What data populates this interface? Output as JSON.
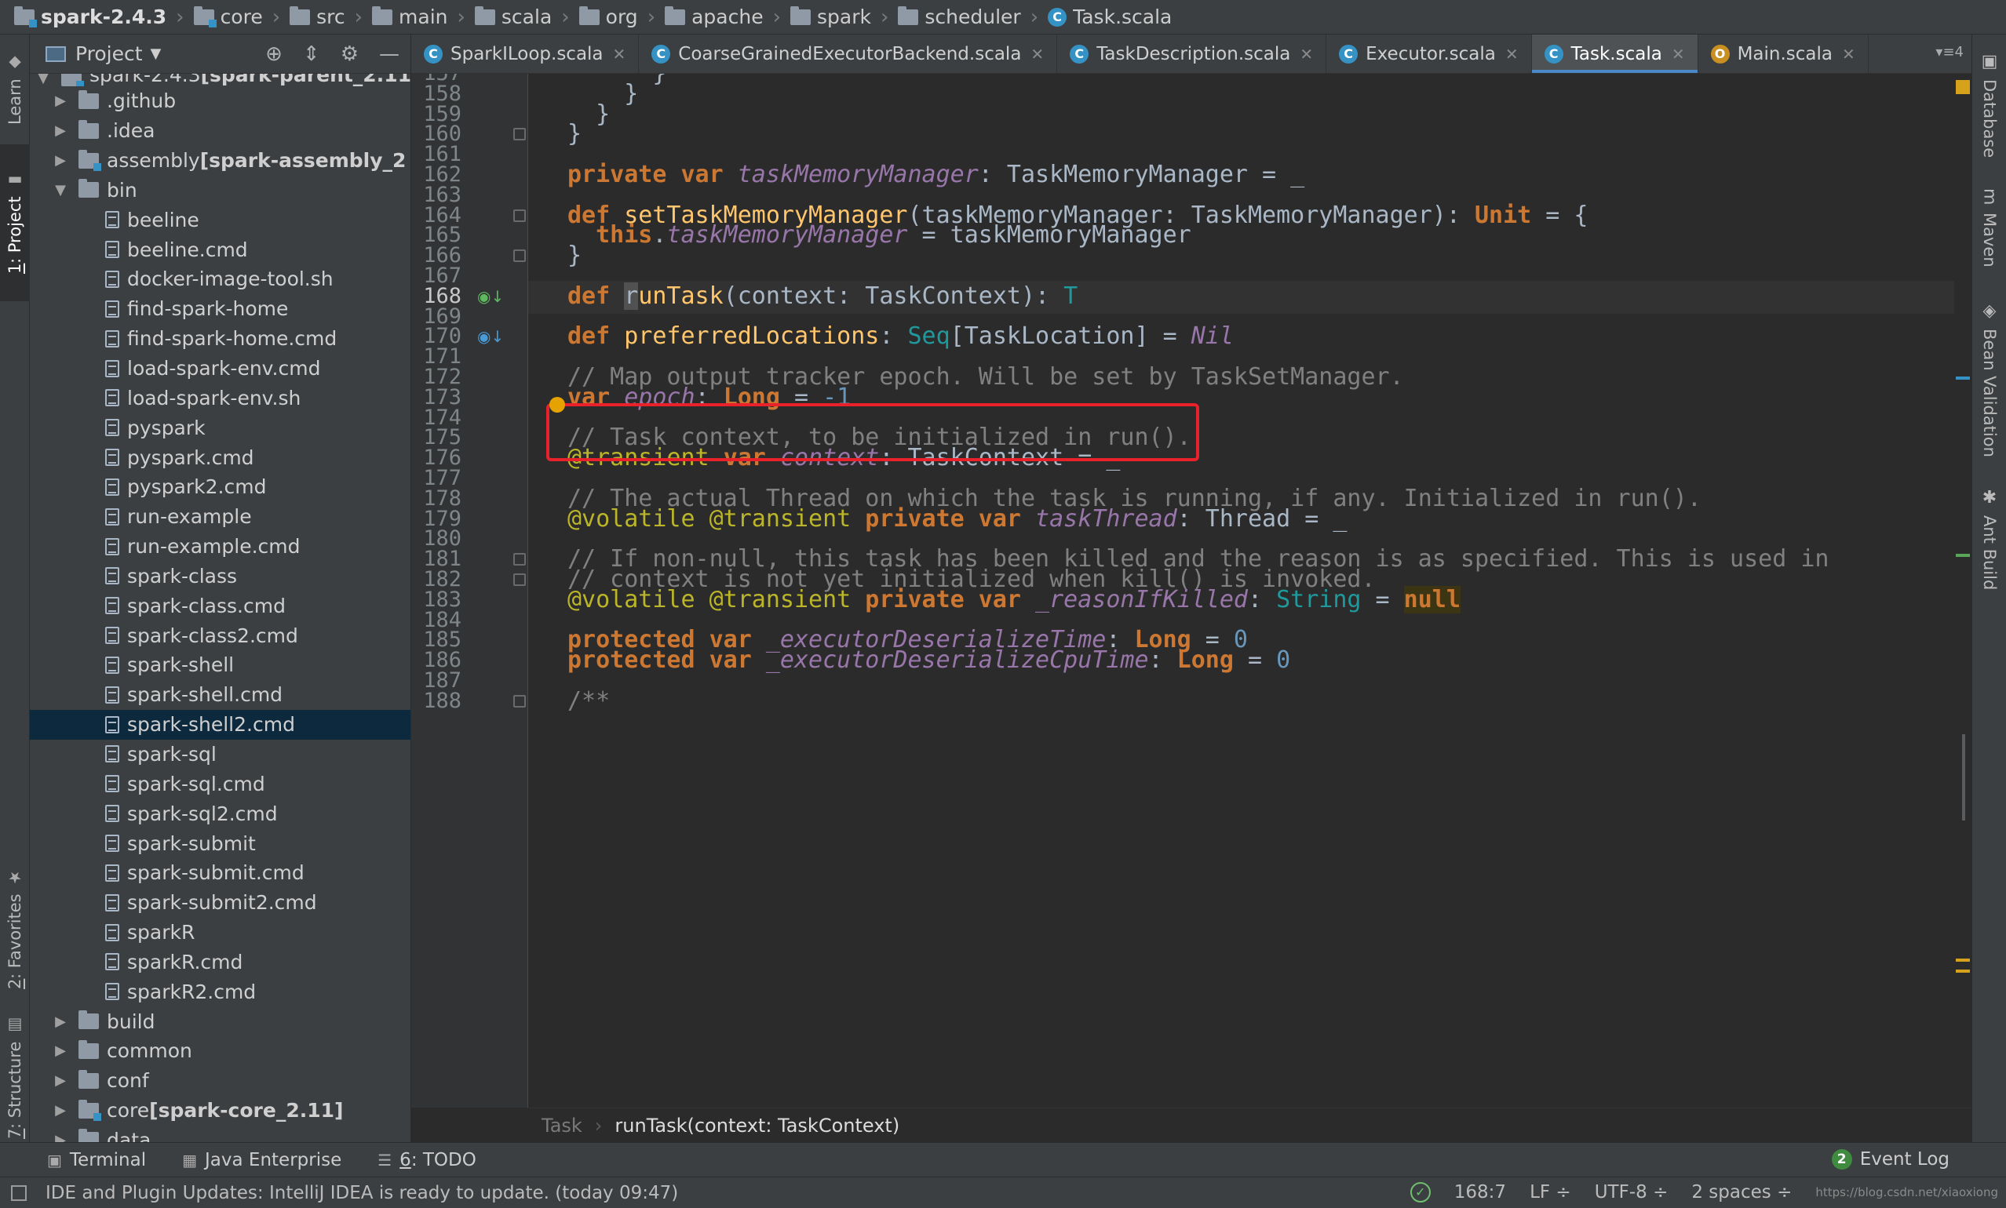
{
  "breadcrumbs": [
    "spark-2.4.3",
    "core",
    "src",
    "main",
    "scala",
    "org",
    "apache",
    "spark",
    "scheduler",
    "Task.scala"
  ],
  "left_tool_windows": {
    "learn": "Learn",
    "project_num": "1",
    "project": ": Project",
    "favorites_num": "2",
    "favorites": ": Favorites",
    "structure_num": "7",
    "structure": ": Structure"
  },
  "project_panel": {
    "title": "Project",
    "partial_top_row": "spark-2.4.3 [spark-parent_2.11",
    "items": [
      {
        "label": "spark-2.4.3",
        "suffix": " [spark-parent_2.11",
        "type": "module",
        "depth": 0,
        "expanded": true
      },
      {
        "label": ".github",
        "type": "folder",
        "depth": 1,
        "expanded": false
      },
      {
        "label": ".idea",
        "type": "folder",
        "depth": 1,
        "expanded": false
      },
      {
        "label": "assembly",
        "suffix": " [spark-assembly_2",
        "type": "module",
        "depth": 1,
        "expanded": false
      },
      {
        "label": "bin",
        "type": "folder",
        "depth": 1,
        "expanded": true
      },
      {
        "label": "beeline",
        "type": "file",
        "depth": 2
      },
      {
        "label": "beeline.cmd",
        "type": "file",
        "depth": 2
      },
      {
        "label": "docker-image-tool.sh",
        "type": "file",
        "depth": 2
      },
      {
        "label": "find-spark-home",
        "type": "file",
        "depth": 2
      },
      {
        "label": "find-spark-home.cmd",
        "type": "file",
        "depth": 2
      },
      {
        "label": "load-spark-env.cmd",
        "type": "file",
        "depth": 2
      },
      {
        "label": "load-spark-env.sh",
        "type": "file",
        "depth": 2
      },
      {
        "label": "pyspark",
        "type": "file",
        "depth": 2
      },
      {
        "label": "pyspark.cmd",
        "type": "file",
        "depth": 2
      },
      {
        "label": "pyspark2.cmd",
        "type": "file",
        "depth": 2
      },
      {
        "label": "run-example",
        "type": "file",
        "depth": 2
      },
      {
        "label": "run-example.cmd",
        "type": "file",
        "depth": 2
      },
      {
        "label": "spark-class",
        "type": "file",
        "depth": 2
      },
      {
        "label": "spark-class.cmd",
        "type": "file",
        "depth": 2
      },
      {
        "label": "spark-class2.cmd",
        "type": "file",
        "depth": 2
      },
      {
        "label": "spark-shell",
        "type": "file",
        "depth": 2
      },
      {
        "label": "spark-shell.cmd",
        "type": "file",
        "depth": 2
      },
      {
        "label": "spark-shell2.cmd",
        "type": "file",
        "depth": 2,
        "selected": true
      },
      {
        "label": "spark-sql",
        "type": "file",
        "depth": 2
      },
      {
        "label": "spark-sql.cmd",
        "type": "file",
        "depth": 2
      },
      {
        "label": "spark-sql2.cmd",
        "type": "file",
        "depth": 2
      },
      {
        "label": "spark-submit",
        "type": "file",
        "depth": 2
      },
      {
        "label": "spark-submit.cmd",
        "type": "file",
        "depth": 2
      },
      {
        "label": "spark-submit2.cmd",
        "type": "file",
        "depth": 2
      },
      {
        "label": "sparkR",
        "type": "file",
        "depth": 2
      },
      {
        "label": "sparkR.cmd",
        "type": "file",
        "depth": 2
      },
      {
        "label": "sparkR2.cmd",
        "type": "file",
        "depth": 2
      },
      {
        "label": "build",
        "type": "folder",
        "depth": 1,
        "expanded": false
      },
      {
        "label": "common",
        "type": "folder",
        "depth": 1,
        "expanded": false
      },
      {
        "label": "conf",
        "type": "folder",
        "depth": 1,
        "expanded": false
      },
      {
        "label": "core",
        "suffix": " [spark-core_2.11]",
        "type": "module",
        "depth": 1,
        "expanded": false
      },
      {
        "label": "data",
        "type": "folder",
        "depth": 1,
        "expanded": false
      }
    ]
  },
  "editor_tabs": [
    {
      "label": "SparkILoop.scala",
      "icon": "scala-class-icon"
    },
    {
      "label": "CoarseGrainedExecutorBackend.scala",
      "icon": "scala-class-icon"
    },
    {
      "label": "TaskDescription.scala",
      "icon": "scala-class-icon"
    },
    {
      "label": "Executor.scala",
      "icon": "scala-class-icon"
    },
    {
      "label": "Task.scala",
      "icon": "scala-class-icon",
      "active": true
    },
    {
      "label": "Main.scala",
      "icon": "scala-object-icon"
    }
  ],
  "tabs_overflow": "4",
  "editor": {
    "first_line": 157,
    "current_line": 168,
    "lines": [
      {
        "n": 157,
        "tokens": [
          [
            "",
            "      }"
          ]
        ]
      },
      {
        "n": 158,
        "tokens": [
          [
            "",
            "    }"
          ]
        ]
      },
      {
        "n": 159,
        "tokens": [
          [
            "",
            "  }"
          ]
        ]
      },
      {
        "n": 160,
        "tokens": [
          [
            "",
            "}"
          ]
        ]
      },
      {
        "n": 161,
        "tokens": []
      },
      {
        "n": 162,
        "tokens": [
          [
            "kw",
            "private var "
          ],
          [
            "fld",
            "taskMemoryManager"
          ],
          [
            "",
            ": TaskMemoryManager = _"
          ]
        ]
      },
      {
        "n": 163,
        "tokens": []
      },
      {
        "n": 164,
        "tokens": [
          [
            "kw",
            "def "
          ],
          [
            "fn",
            "setTaskMemoryManager"
          ],
          [
            "",
            "(taskMemoryManager: TaskMemoryManager): "
          ],
          [
            "kw",
            "Unit"
          ],
          [
            "",
            " = {"
          ]
        ]
      },
      {
        "n": 165,
        "tokens": [
          [
            "kw",
            "  this"
          ],
          [
            "",
            "."
          ],
          [
            "fld",
            "taskMemoryManager"
          ],
          [
            "",
            " = taskMemoryManager"
          ]
        ]
      },
      {
        "n": 166,
        "tokens": [
          [
            "",
            "}"
          ]
        ]
      },
      {
        "n": 167,
        "tokens": []
      },
      {
        "n": 168,
        "tokens": [
          [
            "kw",
            "def "
          ],
          [
            "caret",
            "r"
          ],
          [
            "fn",
            "unTask"
          ],
          [
            "",
            "(context: TaskContext): "
          ],
          [
            "tp",
            "T"
          ]
        ]
      },
      {
        "n": 169,
        "tokens": []
      },
      {
        "n": 170,
        "tokens": [
          [
            "kw",
            "def "
          ],
          [
            "fn",
            "preferredLocations"
          ],
          [
            "",
            ": "
          ],
          [
            "tp",
            "Seq"
          ],
          [
            "",
            "[TaskLocation] = "
          ],
          [
            "nil",
            "Nil"
          ]
        ]
      },
      {
        "n": 171,
        "tokens": []
      },
      {
        "n": 172,
        "tokens": [
          [
            "cm",
            "// Map output tracker epoch. Will be set by TaskSetManager."
          ]
        ]
      },
      {
        "n": 173,
        "tokens": [
          [
            "kw",
            "var "
          ],
          [
            "fld",
            "epoch"
          ],
          [
            "",
            ": "
          ],
          [
            "kw",
            "Long"
          ],
          [
            "",
            " = "
          ],
          [
            "num",
            "-1"
          ]
        ]
      },
      {
        "n": 174,
        "tokens": []
      },
      {
        "n": 175,
        "tokens": [
          [
            "cm",
            "// Task context, to be initialized in run()."
          ]
        ]
      },
      {
        "n": 176,
        "tokens": [
          [
            "an",
            "@transient "
          ],
          [
            "kw",
            "var "
          ],
          [
            "fld",
            "context"
          ],
          [
            "",
            ": TaskContext = _"
          ]
        ]
      },
      {
        "n": 177,
        "tokens": []
      },
      {
        "n": 178,
        "tokens": [
          [
            "cm",
            "// The actual Thread on which the task is running, if any. Initialized in run()."
          ]
        ]
      },
      {
        "n": 179,
        "tokens": [
          [
            "an",
            "@volatile @transient "
          ],
          [
            "kw",
            "private var "
          ],
          [
            "fld",
            "taskThread"
          ],
          [
            "",
            ": Thread = _"
          ]
        ]
      },
      {
        "n": 180,
        "tokens": []
      },
      {
        "n": 181,
        "tokens": [
          [
            "cm",
            "// If non-null, this task has been killed and the reason is as specified. This is used in"
          ]
        ]
      },
      {
        "n": 182,
        "tokens": [
          [
            "cm",
            "// context is not yet initialized when kill() is invoked."
          ]
        ]
      },
      {
        "n": 183,
        "tokens": [
          [
            "an",
            "@volatile @transient "
          ],
          [
            "kw",
            "private var "
          ],
          [
            "fld",
            "_reasonIfKilled"
          ],
          [
            "",
            ": "
          ],
          [
            "tp",
            "String"
          ],
          [
            "",
            " = "
          ],
          [
            "null",
            "null"
          ]
        ]
      },
      {
        "n": 184,
        "tokens": []
      },
      {
        "n": 185,
        "tokens": [
          [
            "kw",
            "protected var "
          ],
          [
            "fld",
            "_executorDeserializeTime"
          ],
          [
            "",
            ": "
          ],
          [
            "kw",
            "Long"
          ],
          [
            "",
            " = "
          ],
          [
            "num",
            "0"
          ]
        ]
      },
      {
        "n": 186,
        "tokens": [
          [
            "kw",
            "protected var "
          ],
          [
            "fld",
            "_executorDeserializeCpuTime"
          ],
          [
            "",
            ": "
          ],
          [
            "kw",
            "Long"
          ],
          [
            "",
            " = "
          ],
          [
            "num",
            "0"
          ]
        ]
      },
      {
        "n": 187,
        "tokens": []
      },
      {
        "n": 188,
        "tokens": [
          [
            "cm",
            "/**"
          ]
        ]
      }
    ]
  },
  "right_tool_windows": [
    "Database",
    "Maven",
    "Bean Validation",
    "Ant Build"
  ],
  "editor_breadcrumb": {
    "left": "Task",
    "right": "runTask(context: TaskContext)"
  },
  "bottom_tools": {
    "terminal": "Terminal",
    "java_enterprise": "Java Enterprise",
    "todo_num": "6",
    "todo": ": TODO",
    "event_log_count": "2",
    "event_log": "Event Log"
  },
  "status": {
    "message": "IDE and Plugin Updates: IntelliJ IDEA is ready to update. (today 09:47)",
    "position": "168:7",
    "line_sep": "LF ÷",
    "encoding": "UTF-8 ÷",
    "indent": "2 spaces ÷",
    "watermark": "https://blog.csdn.net/xiaoxiong"
  }
}
